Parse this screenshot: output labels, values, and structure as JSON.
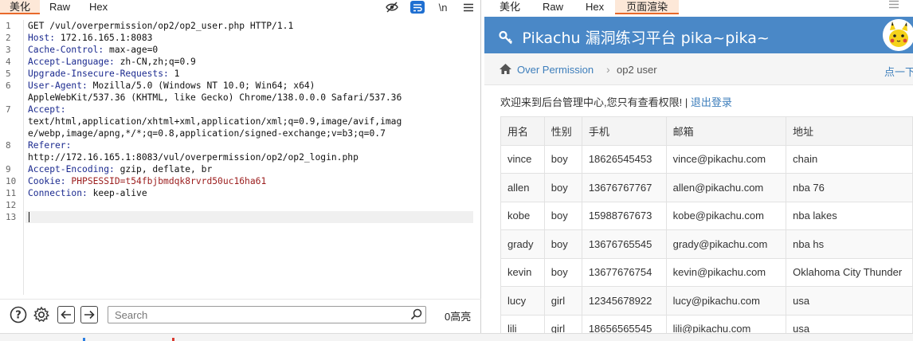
{
  "request_panel": {
    "tabs": [
      "美化",
      "Raw",
      "Hex"
    ],
    "active_tab": 0,
    "tools": {
      "hide_icon": "eye-slash-icon",
      "wrap_icon": "wrap-lines-icon",
      "newline_label": "\\n",
      "menu_icon": "hamburger-icon"
    },
    "lines": [
      {
        "n": "1",
        "key": "GET /vul/overpermission/op2/op2_user.php HTTP/1.1",
        "value": ""
      },
      {
        "n": "2",
        "key": "Host:",
        "value": " 172.16.165.1:8083"
      },
      {
        "n": "3",
        "key": "Cache-Control:",
        "value": " max-age=0"
      },
      {
        "n": "4",
        "key": "Accept-Language:",
        "value": " zh-CN,zh;q=0.9"
      },
      {
        "n": "5",
        "key": "Upgrade-Insecure-Requests:",
        "value": " 1"
      },
      {
        "n": "6",
        "key": "User-Agent:",
        "value": " Mozilla/5.0 (Windows NT 10.0; Win64; x64)"
      },
      {
        "n": "",
        "key": "",
        "value": "AppleWebKit/537.36 (KHTML, like Gecko) Chrome/138.0.0.0 Safari/537.36"
      },
      {
        "n": "7",
        "key": "Accept:",
        "value": ""
      },
      {
        "n": "",
        "key": "",
        "value": "text/html,application/xhtml+xml,application/xml;q=0.9,image/avif,imag"
      },
      {
        "n": "",
        "key": "",
        "value": "e/webp,image/apng,*/*;q=0.8,application/signed-exchange;v=b3;q=0.7"
      },
      {
        "n": "8",
        "key": "Referer:",
        "value": ""
      },
      {
        "n": "",
        "key": "",
        "value": "http://172.16.165.1:8083/vul/overpermission/op2/op2_login.php"
      },
      {
        "n": "9",
        "key": "Accept-Encoding:",
        "value": " gzip, deflate, br"
      },
      {
        "n": "10",
        "key": "Cookie:",
        "value": " PHPSESSID=t54fbjbmdqk8rvrd50uc16ha61",
        "cookie": true
      },
      {
        "n": "11",
        "key": "Connection:",
        "value": " keep-alive"
      },
      {
        "n": "12",
        "key": "",
        "value": ""
      },
      {
        "n": "13",
        "key": "",
        "value": ""
      }
    ],
    "bottom": {
      "help_icon": "help-circle-icon",
      "settings_icon": "gear-icon",
      "back_icon": "arrow-left-icon",
      "forward_icon": "arrow-right-icon",
      "search_placeholder": "Search",
      "search_icon": "search-icon",
      "highlight_count": "0高亮"
    }
  },
  "render_panel": {
    "tabs": [
      "美化",
      "Raw",
      "Hex",
      "页面渲染"
    ],
    "active_tab": 3,
    "banner_title": "Pikachu 漏洞练习平台 pika~pika~",
    "breadcrumb": {
      "link": "Over Permission",
      "current": "op2 user",
      "right_link": "点一下"
    },
    "welcome_text": "欢迎来到后台管理中心,您只有查看权限! | ",
    "logout_text": "退出登录",
    "table_headers": [
      "用名",
      "性别",
      "手机",
      "邮箱",
      "地址"
    ],
    "table_rows": [
      [
        "vince",
        "boy",
        "18626545453",
        "vince@pikachu.com",
        "chain"
      ],
      [
        "allen",
        "boy",
        "13676767767",
        "allen@pikachu.com",
        "nba 76"
      ],
      [
        "kobe",
        "boy",
        "15988767673",
        "kobe@pikachu.com",
        "nba lakes"
      ],
      [
        "grady",
        "boy",
        "13676765545",
        "grady@pikachu.com",
        "nba hs"
      ],
      [
        "kevin",
        "boy",
        "13677676754",
        "kevin@pikachu.com",
        "Oklahoma City Thunder"
      ],
      [
        "lucy",
        "girl",
        "12345678922",
        "lucy@pikachu.com",
        "usa"
      ],
      [
        "lili",
        "girl",
        "18656565545",
        "lili@pikachu.com",
        "usa"
      ]
    ]
  },
  "colors": {
    "accent": "#e8692a",
    "banner": "#4a88c7",
    "link": "#3d7ebb"
  }
}
